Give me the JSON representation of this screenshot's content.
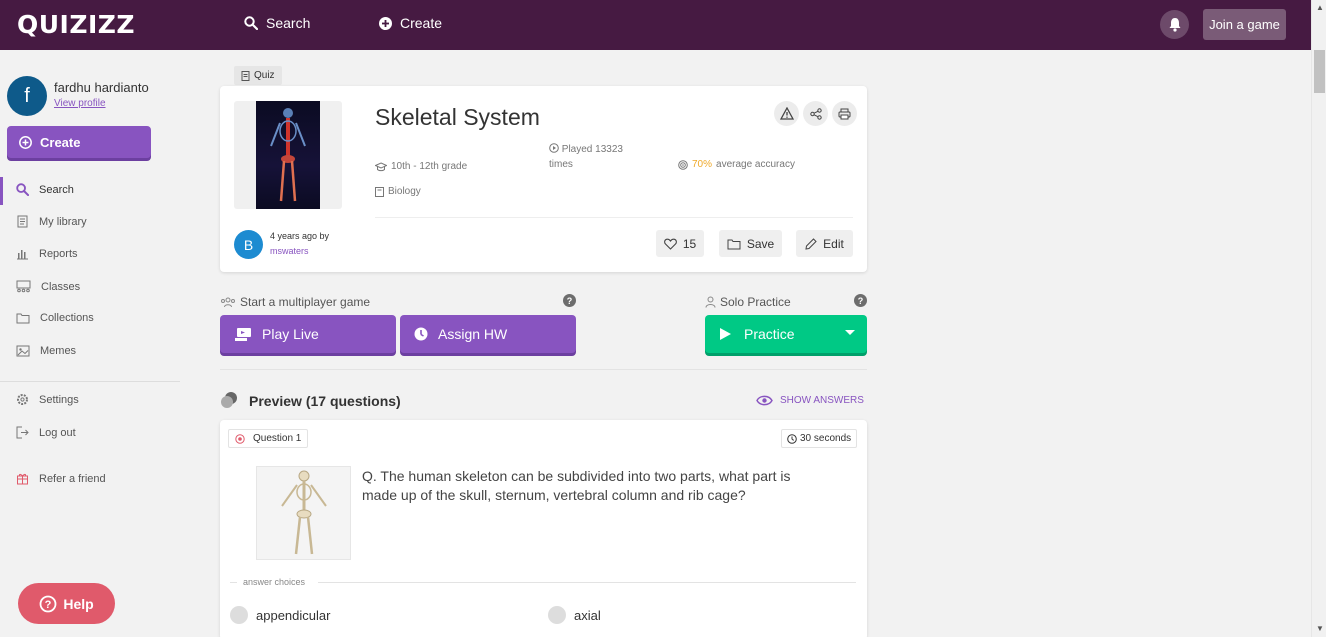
{
  "topbar": {
    "logo": "QUIZIZZ",
    "search_label": "Search",
    "create_label": "Create",
    "join_label": "Join a game"
  },
  "user": {
    "initial": "f",
    "name": "fardhu hardianto",
    "view_profile": "View profile"
  },
  "sidebar": {
    "create_label": "Create",
    "items": [
      {
        "label": "Search",
        "icon": "search-icon"
      },
      {
        "label": "My library",
        "icon": "library-icon"
      },
      {
        "label": "Reports",
        "icon": "reports-icon"
      },
      {
        "label": "Classes",
        "icon": "classes-icon"
      },
      {
        "label": "Collections",
        "icon": "folder-icon"
      },
      {
        "label": "Memes",
        "icon": "image-icon"
      }
    ],
    "settings": "Settings",
    "logout": "Log out",
    "refer": "Refer a friend",
    "help": "Help"
  },
  "quiz": {
    "tag": "Quiz",
    "title": "Skeletal System",
    "grade": "10th - 12th grade",
    "subject": "Biology",
    "played": "Played 13323 times",
    "accuracy_pct": "70%",
    "accuracy_text": "average accuracy",
    "author_initial": "B",
    "author_time": "4 years ago by",
    "author_name": "mswaters",
    "likes": "15",
    "save_label": "Save",
    "edit_label": "Edit"
  },
  "actions": {
    "multiplayer_label": "Start a multiplayer game",
    "solo_label": "Solo Practice",
    "play_live": "Play Live",
    "assign_hw": "Assign HW",
    "practice": "Practice"
  },
  "preview": {
    "title": "Preview (17 questions)",
    "show_answers": "SHOW ANSWERS"
  },
  "question": {
    "label": "Question 1",
    "time": "30 seconds",
    "text": "Q. The human skeleton can be subdivided into two parts, what part is made up of the skull, sternum, vertebral column and rib cage?",
    "answer_choices_label": "answer choices",
    "choices": [
      "appendicular",
      "axial"
    ]
  },
  "colors": {
    "topbar": "#461a42",
    "brand_purple": "#8854c0",
    "practice_green": "#00c985",
    "help_red": "#e05a6b",
    "accuracy_orange": "#efa929"
  }
}
